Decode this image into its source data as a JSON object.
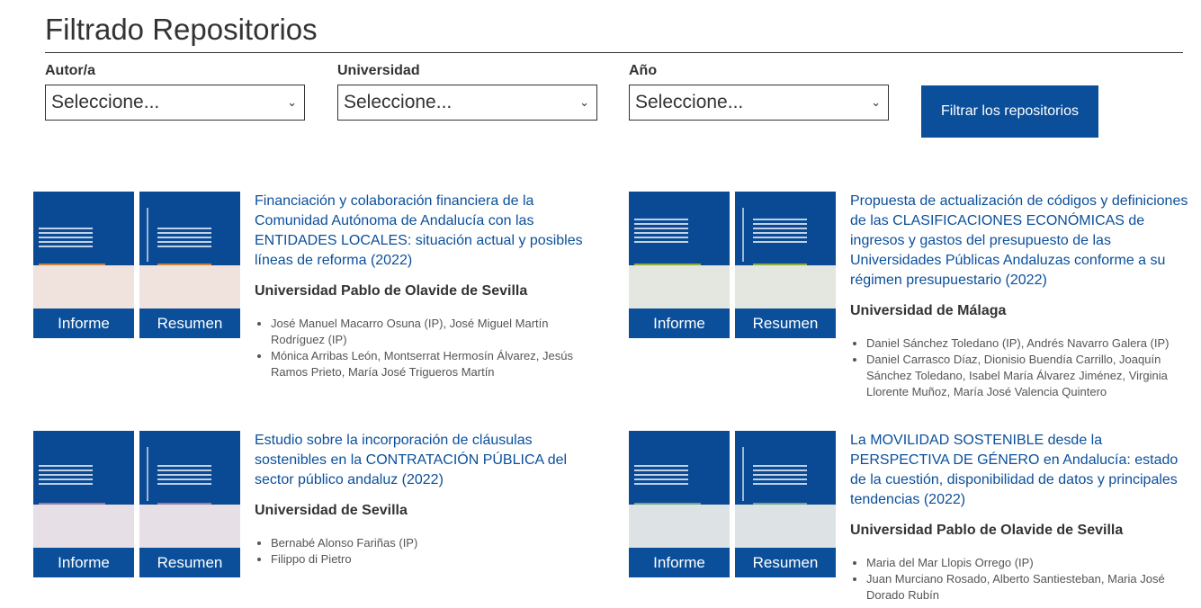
{
  "page": {
    "title": "Filtrado Repositorios"
  },
  "filters": [
    {
      "label": "Autor/a",
      "value": "Seleccione..."
    },
    {
      "label": "Universidad",
      "value": "Seleccione..."
    },
    {
      "label": "Año",
      "value": "Seleccione..."
    }
  ],
  "filter_button": "Filtrar los repositorios",
  "colors": {
    "brand": "#0b4f9b"
  },
  "cards": [
    {
      "title": "Financiación y colaboración financiera de la Comunidad Autónoma de Andalucía con las ENTIDADES LOCALES: situación actual y posibles líneas de reforma (2022)",
      "university": "Universidad Pablo de Olavide de Sevilla",
      "authors": [
        "José Manuel Macarro Osuna (IP), José Miguel Martín Rodríguez (IP)",
        "Mónica Arribas León, Montserrat Hermosín Álvarez, Jesús Ramos Prieto, María José Trigueros Martín"
      ],
      "cover_informe": "Informe",
      "cover_resumen": "Resumen",
      "accent": "#c8853e",
      "paper": "#f0e2dc"
    },
    {
      "title": "Propuesta de actualización de códigos y definiciones de las CLASIFICACIONES ECONÓMICAS de ingresos y gastos del presupuesto de las Universidades Públicas Andaluzas conforme a su régimen presupuestario (2022)",
      "university": "Universidad de Málaga",
      "authors": [
        "Daniel Sánchez Toledano (IP), Andrés Navarro Galera (IP)",
        "Daniel Carrasco Díaz, Dionisio Buendía Carrillo, Joaquín Sánchez Toledano, Isabel María Álvarez Jiménez, Virginia Llorente Muñoz, María José Valencia Quintero"
      ],
      "cover_informe": "Informe",
      "cover_resumen": "Resumen",
      "accent": "#8fae3c",
      "paper": "#e4e6e0"
    },
    {
      "title": "Estudio sobre la incorporación de cláusulas sostenibles en la CONTRATACIÓN PÚBLICA del sector público andaluz (2022)",
      "university": "Universidad de Sevilla",
      "authors": [
        "Bernabé Alonso Fariñas (IP)",
        "Filippo di Pietro"
      ],
      "cover_informe": "Informe",
      "cover_resumen": "Resumen",
      "accent": "#9a7d9c",
      "paper": "#e6dfe6"
    },
    {
      "title": "La MOVILIDAD SOSTENIBLE desde la PERSPECTIVA DE GÉNERO en Andalucía: estado de la cuestión, disponibilidad de datos y principales tendencias (2022)",
      "university": "Universidad Pablo de Olavide de Sevilla",
      "authors": [
        "Maria del Mar Llopis Orrego (IP)",
        "Juan Murciano Rosado, Alberto Santiesteban, Maria José Dorado Rubín"
      ],
      "cover_informe": "Informe",
      "cover_resumen": "Resumen",
      "accent": "#6fa58e",
      "paper": "#dde3e4"
    }
  ]
}
